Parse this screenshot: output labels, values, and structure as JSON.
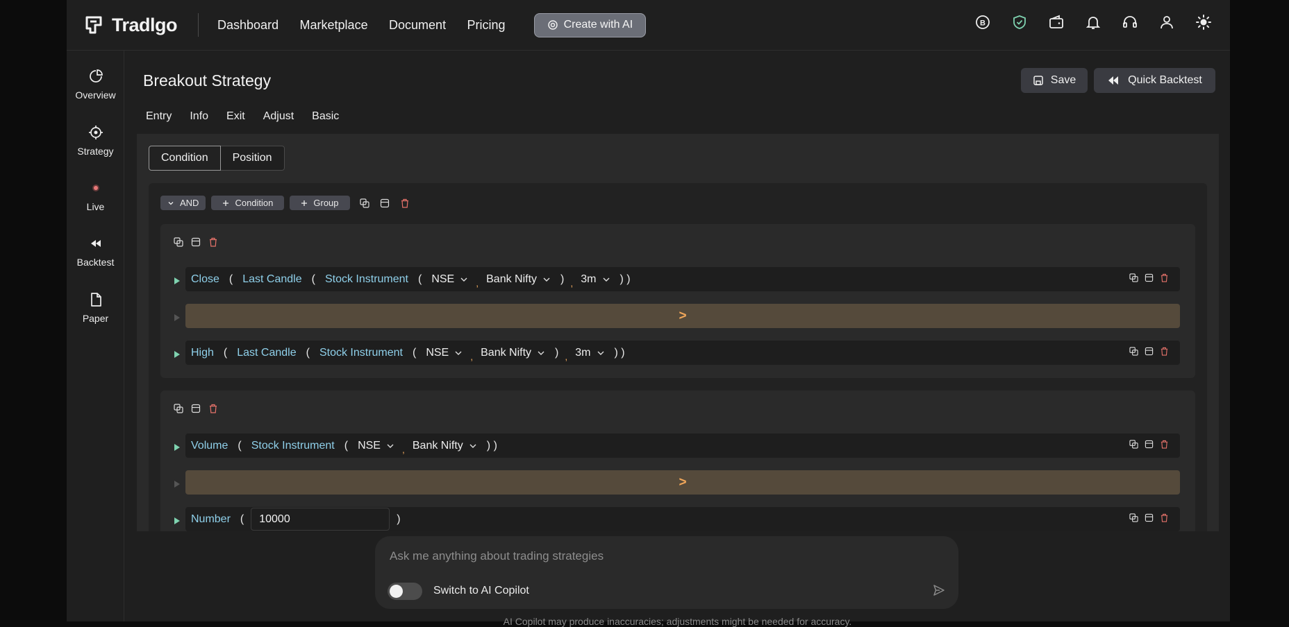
{
  "brand": {
    "name": "Tradlgo"
  },
  "nav": [
    "Dashboard",
    "Marketplace",
    "Document",
    "Pricing"
  ],
  "ai_button": "Create with AI",
  "top_icons": [
    "broker-b-icon",
    "shield-check-icon",
    "wallet-icon",
    "bell-icon",
    "headset-icon",
    "user-icon",
    "sun-icon"
  ],
  "sidebar": [
    {
      "label": "Overview",
      "icon": "pie-chart-icon"
    },
    {
      "label": "Strategy",
      "icon": "target-icon"
    },
    {
      "label": "Live",
      "icon": "live-dot-icon"
    },
    {
      "label": "Backtest",
      "icon": "rewind-icon"
    },
    {
      "label": "Paper",
      "icon": "paper-icon"
    }
  ],
  "page": {
    "title": "Breakout Strategy",
    "save": "Save",
    "quick_backtest": "Quick Backtest",
    "tabs": [
      "Entry",
      "Info",
      "Exit",
      "Adjust",
      "Basic"
    ],
    "segment": [
      "Condition",
      "Position"
    ]
  },
  "builder": {
    "logic": "AND",
    "add_condition": "Condition",
    "add_group": "Group",
    "groups": [
      {
        "left": {
          "fn": "Close",
          "sub": "Last Candle",
          "inst": "Stock Instrument",
          "exchange": "NSE",
          "symbol": "Bank Nifty",
          "tf": "3m"
        },
        "op": ">",
        "right": {
          "fn": "High",
          "sub": "Last Candle",
          "inst": "Stock Instrument",
          "exchange": "NSE",
          "symbol": "Bank Nifty",
          "tf": "3m"
        }
      },
      {
        "left": {
          "fn": "Volume",
          "inst": "Stock Instrument",
          "exchange": "NSE",
          "symbol": "Bank Nifty"
        },
        "op": ">",
        "right": {
          "fn": "Number",
          "value": "10000"
        }
      }
    ]
  },
  "chat": {
    "placeholder": "Ask me anything about trading strategies",
    "toggle_label": "Switch to AI Copilot",
    "disclaimer": "AI Copilot may produce inaccuracies; adjustments might be needed for accuracy."
  },
  "colors": {
    "accent_token": "#8fd0ea",
    "operator": "#f0a65a",
    "operator_bg": "#554a3b",
    "delete": "#e8736b"
  }
}
